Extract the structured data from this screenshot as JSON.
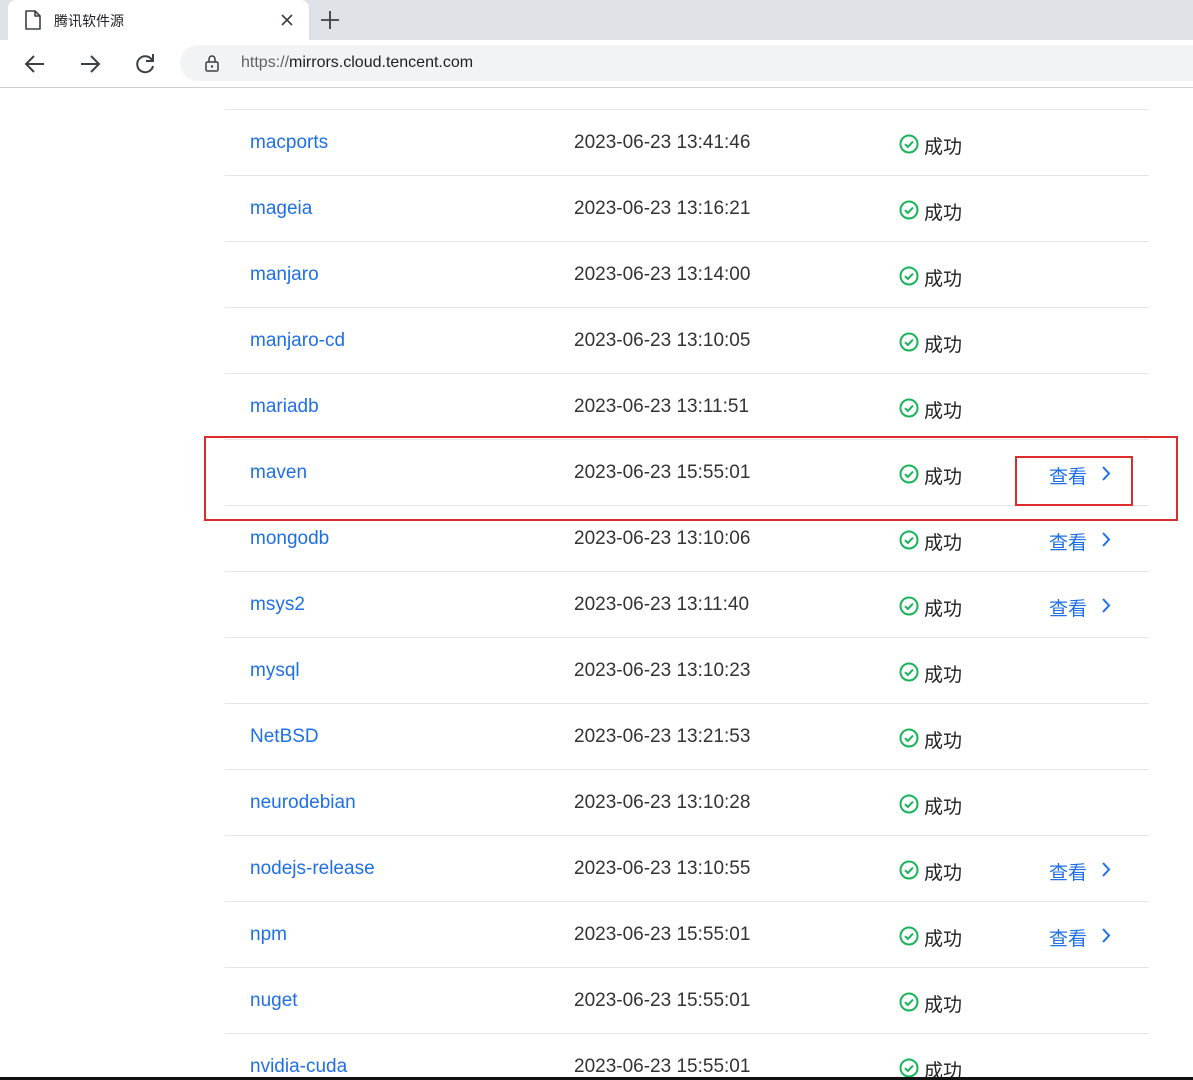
{
  "browser": {
    "tab_title": "腾讯软件源",
    "url_scheme": "https://",
    "url_host": "mirrors.cloud.tencent.com"
  },
  "mirrors": [
    {
      "name": "macports",
      "time": "2023-06-23 13:41:46",
      "status": "成功",
      "view": ""
    },
    {
      "name": "mageia",
      "time": "2023-06-23 13:16:21",
      "status": "成功",
      "view": ""
    },
    {
      "name": "manjaro",
      "time": "2023-06-23 13:14:00",
      "status": "成功",
      "view": ""
    },
    {
      "name": "manjaro-cd",
      "time": "2023-06-23 13:10:05",
      "status": "成功",
      "view": ""
    },
    {
      "name": "mariadb",
      "time": "2023-06-23 13:11:51",
      "status": "成功",
      "view": ""
    },
    {
      "name": "maven",
      "time": "2023-06-23 15:55:01",
      "status": "成功",
      "view": "查看"
    },
    {
      "name": "mongodb",
      "time": "2023-06-23 13:10:06",
      "status": "成功",
      "view": "查看"
    },
    {
      "name": "msys2",
      "time": "2023-06-23 13:11:40",
      "status": "成功",
      "view": "查看"
    },
    {
      "name": "mysql",
      "time": "2023-06-23 13:10:23",
      "status": "成功",
      "view": ""
    },
    {
      "name": "NetBSD",
      "time": "2023-06-23 13:21:53",
      "status": "成功",
      "view": ""
    },
    {
      "name": "neurodebian",
      "time": "2023-06-23 13:10:28",
      "status": "成功",
      "view": ""
    },
    {
      "name": "nodejs-release",
      "time": "2023-06-23 13:10:55",
      "status": "成功",
      "view": "查看"
    },
    {
      "name": "npm",
      "time": "2023-06-23 15:55:01",
      "status": "成功",
      "view": "查看"
    },
    {
      "name": "nuget",
      "time": "2023-06-23 15:55:01",
      "status": "成功",
      "view": ""
    },
    {
      "name": "nvidia-cuda",
      "time": "2023-06-23 15:55:01",
      "status": "成功",
      "view": ""
    }
  ],
  "colors": {
    "link": "#1f6fe5",
    "success": "#19b35a",
    "highlight": "#dd2c2c"
  }
}
